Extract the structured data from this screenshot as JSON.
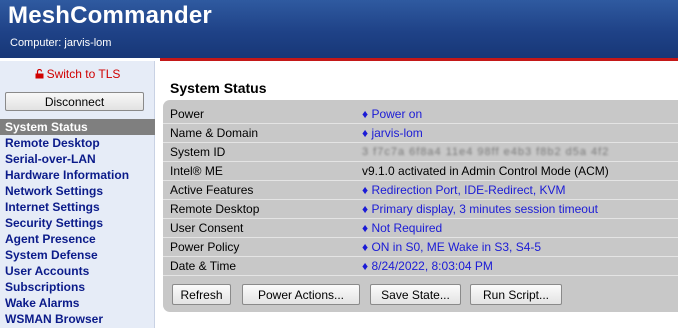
{
  "header": {
    "title": "MeshCommander",
    "computer_line": "Computer: jarvis-lom"
  },
  "sidebar": {
    "tls_link": "Switch to TLS",
    "disconnect_label": "Disconnect",
    "items": [
      {
        "label": "System Status"
      },
      {
        "label": "Remote Desktop"
      },
      {
        "label": "Serial-over-LAN"
      },
      {
        "label": "Hardware Information"
      },
      {
        "label": "Network Settings"
      },
      {
        "label": "Internet Settings"
      },
      {
        "label": "Security Settings"
      },
      {
        "label": "Agent Presence"
      },
      {
        "label": "System Defense"
      },
      {
        "label": "User Accounts"
      },
      {
        "label": "Subscriptions"
      },
      {
        "label": "Wake Alarms"
      },
      {
        "label": "WSMAN Browser"
      }
    ],
    "active_index": 0
  },
  "main": {
    "section_title": "System Status",
    "rows": [
      {
        "label": "Power",
        "value": "♦ Power on"
      },
      {
        "label": "Name & Domain",
        "value": "♦ jarvis-lom"
      },
      {
        "label": "System ID",
        "value": "3 f7c7a 6f8a4 11e4 98ff e4b3 f8b2 d5a 4f2"
      },
      {
        "label": "Intel® ME",
        "value": "v9.1.0 activated in Admin Control Mode (ACM)"
      },
      {
        "label": "Active Features",
        "value": "♦ Redirection Port, IDE-Redirect, KVM"
      },
      {
        "label": "Remote Desktop",
        "value": "♦ Primary display, 3 minutes session timeout"
      },
      {
        "label": "User Consent",
        "value": "♦ Not Required"
      },
      {
        "label": "Power Policy",
        "value": "♦ ON in S0, ME Wake in S3, S4-5"
      },
      {
        "label": "Date & Time",
        "value": "♦ 8/24/2022, 8:03:04 PM"
      }
    ],
    "buttons": {
      "refresh": "Refresh",
      "power_actions": "Power Actions...",
      "save_state": "Save State...",
      "run_script": "Run Script..."
    }
  },
  "colors": {
    "header_blue": "#1f4287",
    "accent_red": "#c41818",
    "link_blue": "#1b1bd6",
    "nav_text": "#0b1b8a",
    "active_bg": "#7f7f7f",
    "panel_bg": "#c8c8c8"
  },
  "icons": {
    "tls_icon": "open-lock-icon"
  }
}
